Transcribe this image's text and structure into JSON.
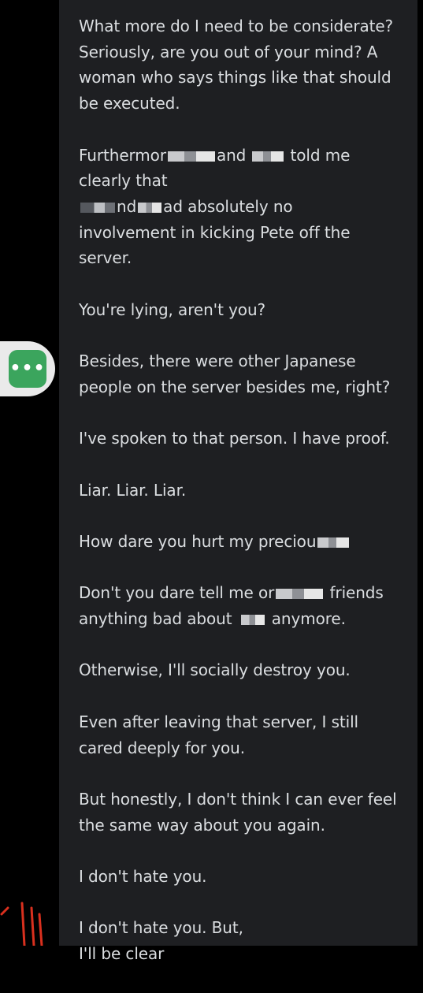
{
  "messages": [
    {
      "lines": [
        "What more do I need to be considerate?",
        "Seriously, are you out of your mind? A",
        "woman who says things like that should",
        "be executed."
      ]
    },
    {
      "lines": [
        "Furthermor",
        "and",
        "told me",
        "clearly that",
        "nd",
        "ad absolutely no",
        "involvement in kicking Pete off the",
        "server."
      ]
    },
    {
      "lines": [
        "You're lying, aren't you?"
      ]
    },
    {
      "lines": [
        "Besides, there were other Japanese",
        "people on the server besides me, right?"
      ]
    },
    {
      "lines": [
        "I've spoken to that person. I have proof."
      ]
    },
    {
      "lines": [
        "Liar. Liar. Liar."
      ]
    },
    {
      "lines": [
        "How dare you hurt my preciou"
      ]
    },
    {
      "lines": [
        "Don't you dare tell me or",
        "friends",
        "anything bad about",
        "anymore."
      ]
    },
    {
      "lines": [
        "Otherwise, I'll socially destroy you."
      ]
    },
    {
      "lines": [
        "Even after leaving that server, I still",
        "cared deeply for you."
      ]
    },
    {
      "lines": [
        "But honestly, I don't think I can ever feel",
        "the same way about you again."
      ]
    },
    {
      "lines": [
        "I don't hate you."
      ]
    },
    {
      "lines": [
        "I don't hate you. But,",
        "I'll be clear"
      ]
    }
  ],
  "bubble": {
    "icon": "more-dots-icon",
    "glyph": "•••",
    "color": "#3ba55d"
  },
  "colors": {
    "background": "#1e1f22",
    "text": "#dbdee1",
    "edge": "#000000"
  }
}
